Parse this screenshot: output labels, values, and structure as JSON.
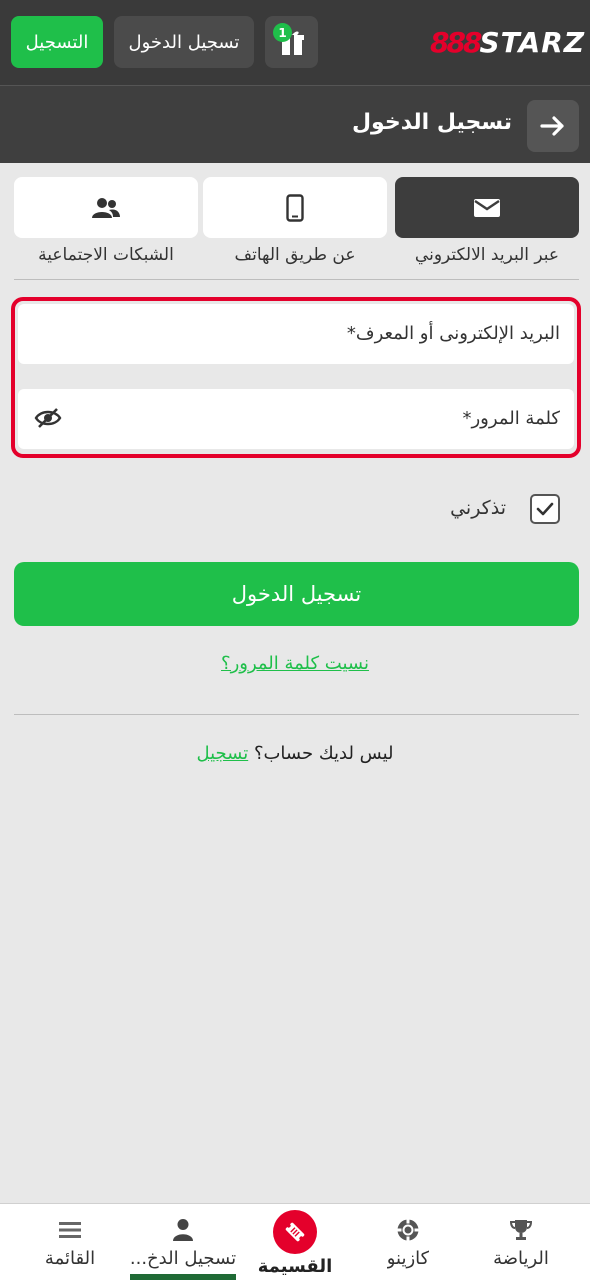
{
  "header": {
    "logo_number": "888",
    "logo_text": "STARZ",
    "register_label": "التسجيل",
    "login_label": "تسجيل الدخول",
    "gift_badge": "1"
  },
  "subheader": {
    "title": "تسجيل الدخول"
  },
  "methods": [
    {
      "label": "عبر البريد الالكتروني",
      "icon": "envelope-icon",
      "active": true
    },
    {
      "label": "عن طريق الهاتف",
      "icon": "phone-icon",
      "active": false
    },
    {
      "label": "الشبكات الاجتماعية",
      "icon": "users-icon",
      "active": false
    }
  ],
  "form": {
    "email_placeholder": "البريد الإلكترونى أو المعرف*",
    "password_placeholder": "كلمة المرور*",
    "remember_label": "تذكرني",
    "remember_checked": true,
    "submit_label": "تسجيل الدخول",
    "forgot_label": "نسيت كلمة المرور؟",
    "no_account_text": "ليس لديك حساب؟",
    "signup_link": "تسجيل"
  },
  "bottom_nav": [
    {
      "label": "الرياضة",
      "icon": "trophy-icon"
    },
    {
      "label": "كازينو",
      "icon": "chip-icon"
    },
    {
      "label": "القسيمة",
      "icon": "ticket-icon"
    },
    {
      "label": "تسجيل الدخ...",
      "icon": "user-icon"
    },
    {
      "label": "القائمة",
      "icon": "menu-icon"
    }
  ],
  "colors": {
    "brand_green": "#1fbf4a",
    "brand_red": "#e4002b",
    "header_bg": "#3a3a3a"
  }
}
